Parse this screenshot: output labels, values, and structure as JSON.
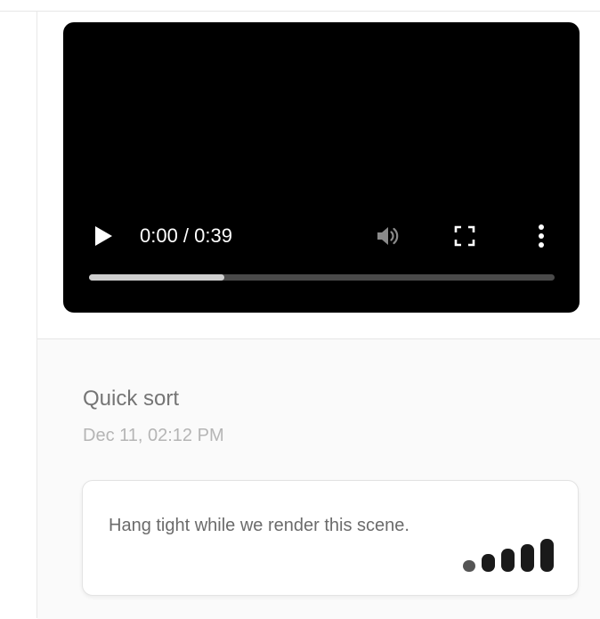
{
  "video": {
    "time_display": "0:00 / 0:39",
    "progress_fraction": 0.29,
    "icons": [
      "play-icon",
      "volume-icon",
      "fullscreen-icon",
      "more-options-icon"
    ]
  },
  "item": {
    "title": "Quick sort",
    "timestamp": "Dec 11, 02:12 PM"
  },
  "status_card": {
    "message": "Hang tight while we render this scene.",
    "icon": "loading-bars-icon"
  },
  "colors": {
    "video_bg": "#000000",
    "progress_track": "#4a4a4a",
    "progress_fill": "#cfcfcf",
    "title_text": "#757575",
    "timestamp_text": "#b5b5b5",
    "loader_bar": "#1a1a1a"
  }
}
